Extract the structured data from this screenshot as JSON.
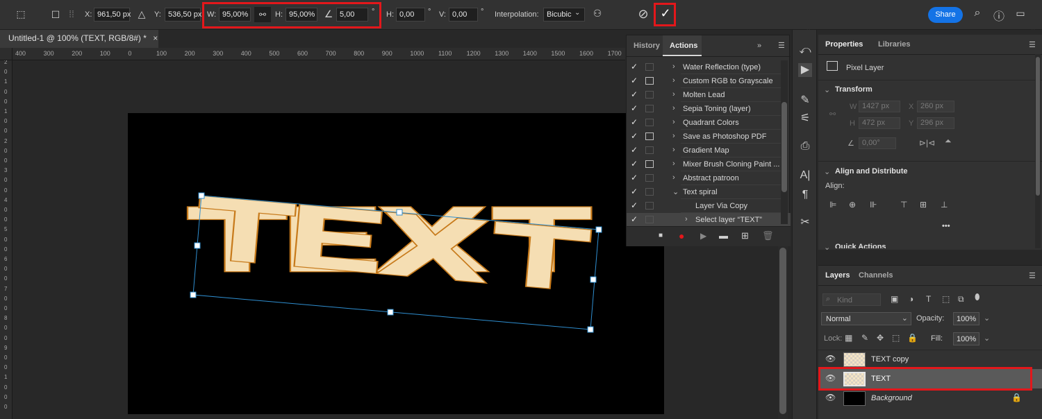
{
  "optionbar": {
    "x_label": "X:",
    "x_value": "961,50 px",
    "y_label": "Y:",
    "y_value": "536,50 px",
    "w_label": "W:",
    "w_value": "95,00%",
    "h_label": "H:",
    "h_value": "95,00%",
    "angle_value": "5,00",
    "angle_unit": "°",
    "hskew_label": "H:",
    "hskew_value": "0,00",
    "hskew_unit": "°",
    "vskew_label": "V:",
    "vskew_value": "0,00",
    "vskew_unit": "°",
    "interp_label": "Interpolation:",
    "interp_value": "Bicubic",
    "share_label": "Share"
  },
  "document": {
    "tab_title": "Untitled-1 @ 100% (TEXT, RGB/8#) *",
    "close": "×",
    "canvas_text": "TEXT",
    "ruler_h": [
      "400",
      "300",
      "200",
      "100",
      "0",
      "100",
      "200",
      "300",
      "400",
      "500",
      "600",
      "700",
      "800",
      "900",
      "1000",
      "1100",
      "1200",
      "1300",
      "1400",
      "1500",
      "1600",
      "1700"
    ],
    "ruler_v": [
      "2",
      "0",
      "1",
      "0",
      "0",
      "1",
      "0",
      "0",
      "2",
      "0",
      "0",
      "3",
      "0",
      "0",
      "4",
      "0",
      "0",
      "5",
      "0",
      "0",
      "6",
      "0",
      "0",
      "7",
      "0",
      "0",
      "8",
      "0",
      "0",
      "9",
      "0",
      "0",
      "1",
      "0",
      "0",
      "0"
    ]
  },
  "actions_panel": {
    "tab_history": "History",
    "tab_actions": "Actions",
    "items": [
      {
        "label": "Water Reflection (type)",
        "caret": "›",
        "dialog": false
      },
      {
        "label": "Custom RGB to Grayscale",
        "caret": "›",
        "dialog": true
      },
      {
        "label": "Molten Lead",
        "caret": "›",
        "dialog": false
      },
      {
        "label": "Sepia Toning (layer)",
        "caret": "›",
        "dialog": false
      },
      {
        "label": "Quadrant Colors",
        "caret": "›",
        "dialog": false
      },
      {
        "label": "Save as Photoshop PDF",
        "caret": "›",
        "dialog": true
      },
      {
        "label": "Gradient Map",
        "caret": "›",
        "dialog": false
      },
      {
        "label": "Mixer Brush Cloning Paint ...",
        "caret": "›",
        "dialog": true
      },
      {
        "label": "Abstract patroon",
        "caret": "›",
        "dialog": false
      },
      {
        "label": "Text spiral",
        "caret": "⌄",
        "dialog": false
      },
      {
        "label": "Layer Via Copy",
        "caret": "",
        "dialog": false
      },
      {
        "label": "Select layer “TEXT”",
        "caret": "›",
        "dialog": false
      }
    ]
  },
  "properties": {
    "tab_properties": "Properties",
    "tab_libraries": "Libraries",
    "kind": "Pixel Layer",
    "transform_title": "Transform",
    "w_label": "W",
    "w_value": "1427 px",
    "x_label": "X",
    "x_value": "260 px",
    "h_label": "H",
    "h_value": "472 px",
    "y_label": "Y",
    "y_value": "296 px",
    "angle_value": "0,00°",
    "align_title": "Align and Distribute",
    "align_label": "Align:",
    "more": "•••",
    "quick_title": "Quick Actions"
  },
  "layers": {
    "tab_layers": "Layers",
    "tab_channels": "Channels",
    "kind_placeholder": "Kind",
    "blend_mode": "Normal",
    "opacity_label": "Opacity:",
    "opacity_value": "100%",
    "lock_label": "Lock:",
    "fill_label": "Fill:",
    "fill_value": "100%",
    "items": [
      {
        "name": "TEXT copy"
      },
      {
        "name": "TEXT"
      },
      {
        "name": "Background"
      }
    ]
  },
  "colors": {
    "accent": "#1473e6",
    "highlight": "#e3171b",
    "text_fill": "#f5deb3",
    "text_stroke": "#c77a1b",
    "bbox": "#2f8fd1"
  }
}
